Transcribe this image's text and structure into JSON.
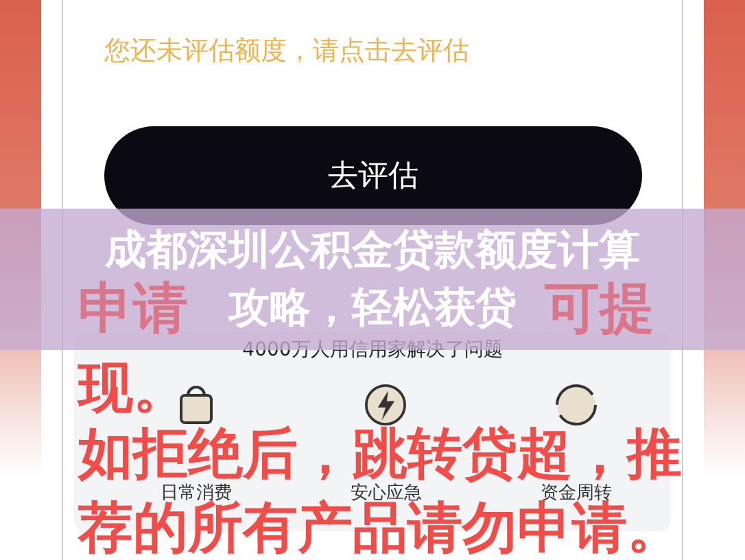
{
  "app": {
    "hint": "您还未评估额度，请点击去评估",
    "button": "去评估",
    "panel": {
      "caption": "4000万人用信用家解决了问题",
      "features": [
        {
          "label": "日常消费",
          "kind": "bag"
        },
        {
          "label": "安心应急",
          "kind": "bolt"
        },
        {
          "label": "资金周转",
          "kind": "cycle"
        }
      ]
    }
  },
  "annotation": {
    "first_line": [
      "申请",
      "可提"
    ],
    "lines": [
      "现。",
      "如拒绝后，跳转贷超，推",
      "荐的所有产品请勿申请。"
    ]
  },
  "banner": {
    "title_lines": [
      "成都深圳公积金贷款额度计算",
      "攻略，轻松获贷"
    ]
  }
}
